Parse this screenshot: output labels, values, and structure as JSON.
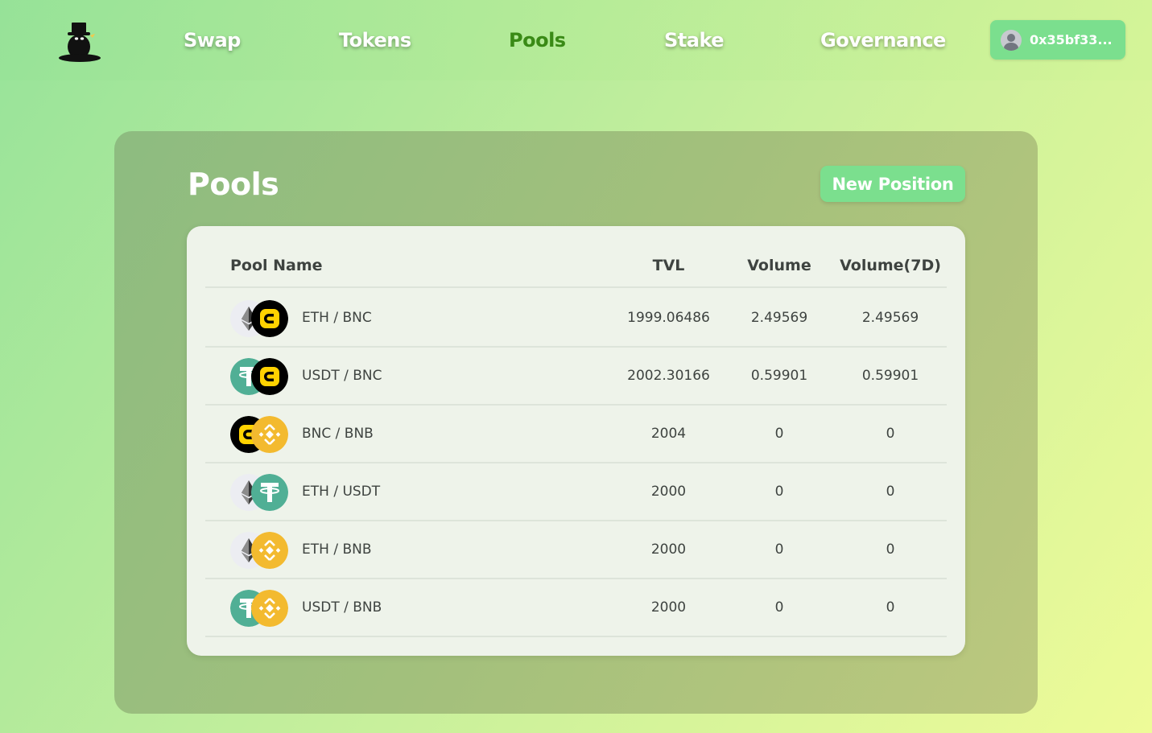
{
  "nav": {
    "logo_icon": "mole-with-top-hat-logo-icon",
    "links": [
      "Swap",
      "Tokens",
      "Pools",
      "Stake",
      "Governance"
    ],
    "active": "Pools",
    "wallet": {
      "address": "0x35bf33...",
      "icon": "user-avatar-icon"
    }
  },
  "main": {
    "title": "Pools",
    "new_position_label": "New Position"
  },
  "table": {
    "headers": {
      "pool_name": "Pool Name",
      "tvl": "TVL",
      "volume": "Volume",
      "volume_7d": "Volume(7D)"
    },
    "rows": [
      {
        "name": "ETH / BNC",
        "token_a": "eth",
        "token_b": "bnc",
        "tvl": "1999.06486",
        "volume": "2.49569",
        "volume_7d": "2.49569"
      },
      {
        "name": "USDT / BNC",
        "token_a": "usdt",
        "token_b": "bnc",
        "tvl": "2002.30166",
        "volume": "0.59901",
        "volume_7d": "0.59901"
      },
      {
        "name": "BNC / BNB",
        "token_a": "bnc",
        "token_b": "bnb",
        "tvl": "2004",
        "volume": "0",
        "volume_7d": "0"
      },
      {
        "name": "ETH / USDT",
        "token_a": "eth",
        "token_b": "usdt",
        "tvl": "2000",
        "volume": "0",
        "volume_7d": "0"
      },
      {
        "name": "ETH / BNB",
        "token_a": "eth",
        "token_b": "bnb",
        "tvl": "2000",
        "volume": "0",
        "volume_7d": "0"
      },
      {
        "name": "USDT / BNB",
        "token_a": "usdt",
        "token_b": "bnb",
        "tvl": "2000",
        "volume": "0",
        "volume_7d": "0"
      }
    ]
  },
  "colors": {
    "accent": "#7bdf8e",
    "active_nav": "#3a8a16",
    "usdt": "#50af95",
    "bnb": "#f3ba2f",
    "bnc": "#000000",
    "bnc_mark": "#ffd200"
  }
}
